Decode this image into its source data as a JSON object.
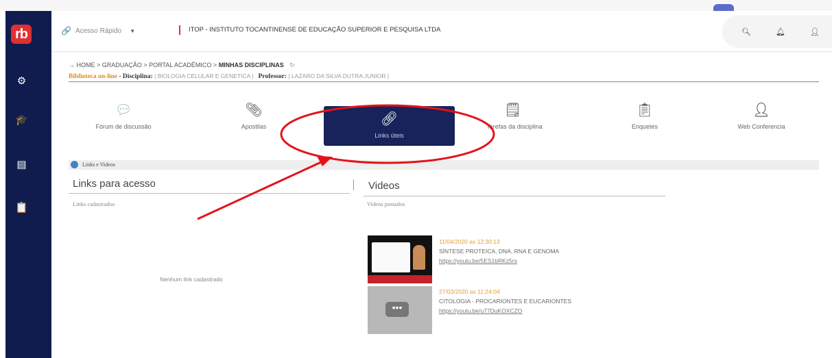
{
  "app": {
    "logo_text": "rb"
  },
  "sidebar": {
    "items": [
      {
        "icon": "gears-icon",
        "glyph": "⚙"
      },
      {
        "icon": "graduation-cap-icon",
        "glyph": "🎓"
      },
      {
        "icon": "book-icon",
        "glyph": "▤"
      },
      {
        "icon": "clipboard-icon",
        "glyph": "📋"
      }
    ]
  },
  "header": {
    "quick_access_label": "Acesso Rápido",
    "institution": "ITOP - INSTITUTO TOCANTINENSE DE EDUCAÇÃO SUPERIOR E PESQUISA LTDA",
    "icons": [
      "search-icon",
      "bell-icon",
      "user-icon"
    ]
  },
  "breadcrumb": {
    "home": "HOME",
    "graduacao": "GRADUAÇÃO",
    "portal": "PORTAL ACADÊMICO",
    "current": "MINHAS DISCIPLINAS"
  },
  "discipline": {
    "library": "Biblioteca on-line",
    "disc_label": "Disciplina:",
    "disc_value": "BIOLOGIA CELULAR E GENETICA",
    "prof_label": "Professor:",
    "prof_value": "LAZARO DA SILVA DUTRA JUNIOR"
  },
  "tabs": [
    {
      "label": "Fórum de discussão",
      "icon": "chat-bubble-icon"
    },
    {
      "label": "Apostilas",
      "icon": "paperclip-icon"
    },
    {
      "label": "Links úteis",
      "icon": "link-icon",
      "active": true
    },
    {
      "label": "Tarefas da disciplina",
      "icon": "task-icon"
    },
    {
      "label": "Enquetes",
      "icon": "clipboard-list-icon"
    },
    {
      "label": "Web Conferencia",
      "icon": "presenter-icon"
    }
  ],
  "panel": {
    "bar_title": "Links e Videos",
    "links_title": "Links para acesso",
    "links_sub": "Links cadastrados",
    "no_links": "Nenhum link cadastrado",
    "videos_title": "Videos",
    "videos_sub": "Videos postados",
    "videos": [
      {
        "date": "11/04/2020 as 12:30:13",
        "title": "SÍNTESE PROTEICA, DNA, RNA E GENOMA",
        "url": "https://youtu.be/5ES1bRKz5rs"
      },
      {
        "date": "27/03/2020 as 11:24:04",
        "title": "CITOLOGIA - PROCARIONTES E EUCARIONTES",
        "url": "https://youtu.be/u77DuKOXCZO"
      }
    ]
  },
  "annotation_color": "#e3131b"
}
